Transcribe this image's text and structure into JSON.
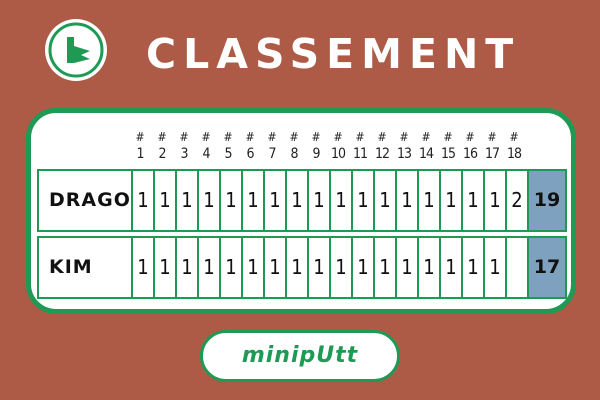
{
  "title": "CLASSEMENT",
  "holes": [
    "1",
    "2",
    "3",
    "4",
    "5",
    "6",
    "7",
    "8",
    "9",
    "10",
    "11",
    "12",
    "13",
    "14",
    "15",
    "16",
    "17",
    "18"
  ],
  "hole_prefix": "#",
  "players": [
    {
      "name": "DRAGO",
      "scores": [
        "1",
        "1",
        "1",
        "1",
        "1",
        "1",
        "1",
        "1",
        "1",
        "1",
        "1",
        "1",
        "1",
        "1",
        "1",
        "1",
        "1",
        "2"
      ],
      "total": "19"
    },
    {
      "name": "KIM",
      "scores": [
        "1",
        "1",
        "1",
        "1",
        "1",
        "1",
        "1",
        "1",
        "1",
        "1",
        "1",
        "1",
        "1",
        "1",
        "1",
        "1",
        "1",
        ""
      ],
      "total": "17"
    }
  ],
  "brand": "minipUtt",
  "colors": {
    "background": "#ad5b46",
    "accent_green": "#1e9a55",
    "total_cell": "#7da1bf"
  },
  "icons": {
    "logo": "minigolf-club-logo-icon"
  }
}
